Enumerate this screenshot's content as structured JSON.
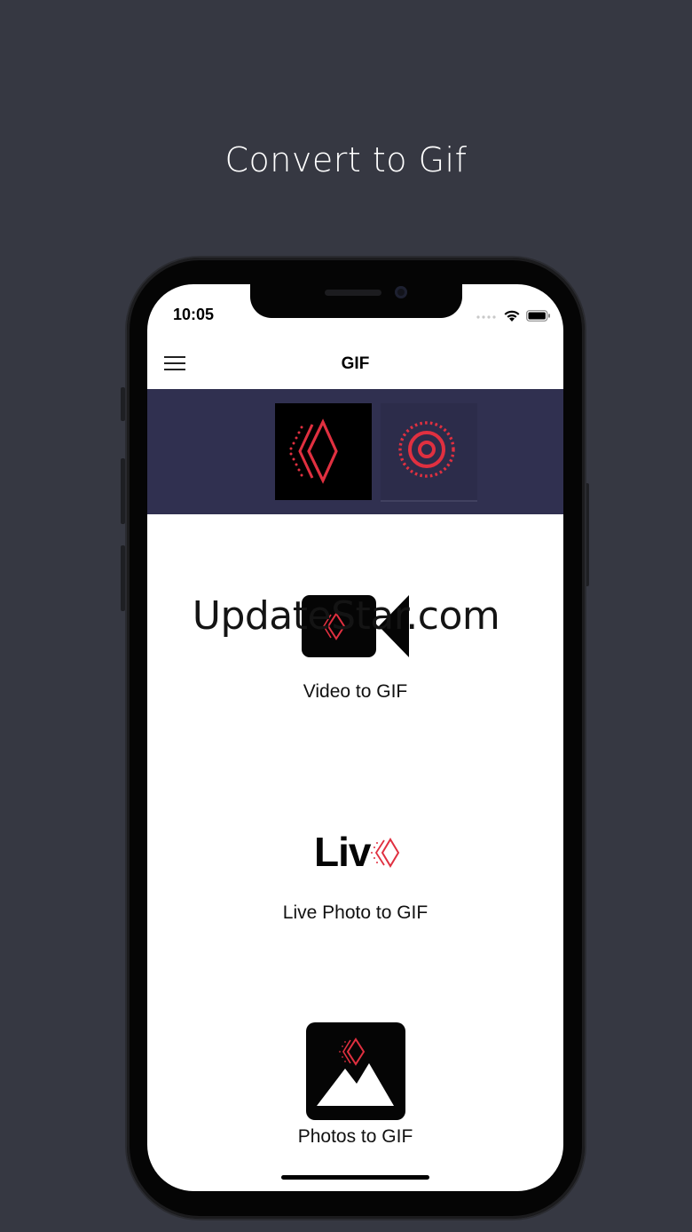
{
  "headline": "Convert to Gif",
  "status_bar": {
    "time": "10:05"
  },
  "nav": {
    "title": "GIF",
    "menu_icon": "hamburger-menu-icon"
  },
  "tabs": [
    {
      "icon": "gif-logo-icon",
      "selected": true
    },
    {
      "icon": "live-target-icon",
      "selected": false
    }
  ],
  "options": [
    {
      "label": "Video to GIF",
      "icon": "video-camera-icon"
    },
    {
      "label": "Live Photo to GIF",
      "icon": "live-logo-icon",
      "logo_text": "Liv"
    },
    {
      "label": "Photos to GIF",
      "icon": "photo-mountains-icon"
    }
  ],
  "watermark": "UpdateStar.com",
  "colors": {
    "background": "#363842",
    "tab_strip": "#303050",
    "accent_red": "#e03040"
  }
}
